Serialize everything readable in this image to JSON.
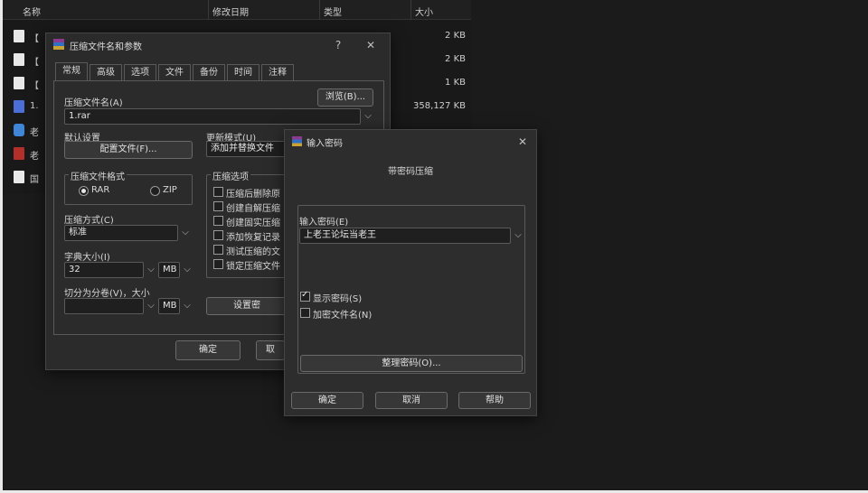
{
  "explorer": {
    "columns": {
      "name": "名称",
      "modified": "修改日期",
      "type": "类型",
      "size": "大小"
    },
    "files": [
      {
        "name": "【",
        "size": "2 KB",
        "icon": "document-icon"
      },
      {
        "name": "【",
        "size": "2 KB",
        "icon": "document-icon"
      },
      {
        "name": "【",
        "size": "1 KB",
        "icon": "document-icon"
      },
      {
        "name": "1.",
        "size": "358,127 KB",
        "icon": "video-file-icon"
      },
      {
        "name": "老",
        "size": "",
        "icon": "app-icon"
      },
      {
        "name": "老",
        "size": "",
        "icon": "winrar-archive-icon"
      },
      {
        "name": "国",
        "size": "",
        "icon": "document-icon"
      }
    ]
  },
  "archive_dialog": {
    "title": "压缩文件名和参数",
    "help_btn": "?",
    "close_btn": "✕",
    "tabs": [
      "常规",
      "高级",
      "选项",
      "文件",
      "备份",
      "时间",
      "注释"
    ],
    "archive_name_label": "压缩文件名(A)",
    "browse_button": "浏览(B)...",
    "archive_name_value": "1.rar",
    "default_settings_label": "默认设置",
    "profiles_button": "配置文件(F)...",
    "update_mode_label": "更新模式(U)",
    "update_mode_value": "添加并替换文件",
    "format_group_label": "压缩文件格式",
    "format_rar": "RAR",
    "format_zip": "ZIP",
    "options_group_label": "压缩选项",
    "options": [
      "压缩后删除原",
      "创建自解压缩",
      "创建固实压缩",
      "添加恢复记录",
      "测试压缩的文",
      "锁定压缩文件"
    ],
    "method_label": "压缩方式(C)",
    "method_value": "标准",
    "dict_label": "字典大小(I)",
    "dict_value": "32",
    "dict_unit": "MB",
    "split_label": "切分为分卷(V)，大小",
    "split_value": "",
    "split_unit": "MB",
    "set_password_button": "设置密",
    "ok_button": "确定",
    "cancel_button": "取"
  },
  "password_dialog": {
    "title": "输入密码",
    "close_btn": "✕",
    "heading": "带密码压缩",
    "password_label": "输入密码(E)",
    "password_value": "上老王论坛当老王",
    "show_password_label": "显示密码(S)",
    "show_password_checked": true,
    "encrypt_names_label": "加密文件名(N)",
    "encrypt_names_checked": false,
    "organize_button": "整理密码(O)...",
    "ok_button": "确定",
    "cancel_button": "取消",
    "help_button": "帮助"
  }
}
